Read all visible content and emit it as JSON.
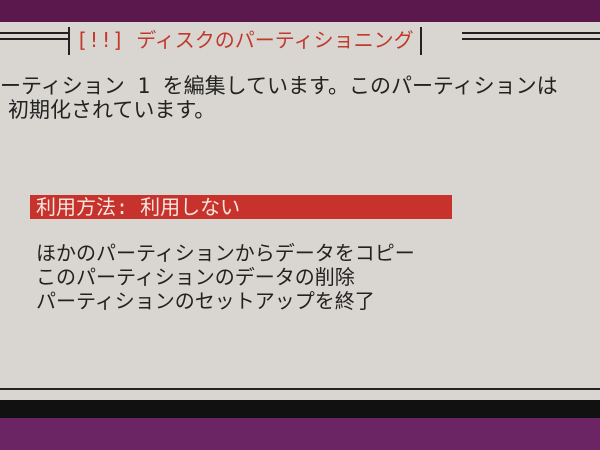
{
  "dialog": {
    "title": "[!!] ディスクのパーティショニング",
    "message_lines": [
      "ーティション 1 を編集しています。このパーティションは",
      "初期化されています。"
    ]
  },
  "menu": {
    "items": [
      {
        "label": "利用方法:  利用しない",
        "selected": true
      },
      {
        "label": "ほかのパーティションからデータをコピー",
        "selected": false
      },
      {
        "label": "このパーティションのデータの削除",
        "selected": false
      },
      {
        "label": "パーティションのセットアップを終了",
        "selected": false
      }
    ]
  },
  "colors": {
    "dialog_background": "#d9d6d1",
    "title_text": "#c0392b",
    "selection_background": "#c8322c",
    "desktop_background": "#6a1f5a"
  }
}
